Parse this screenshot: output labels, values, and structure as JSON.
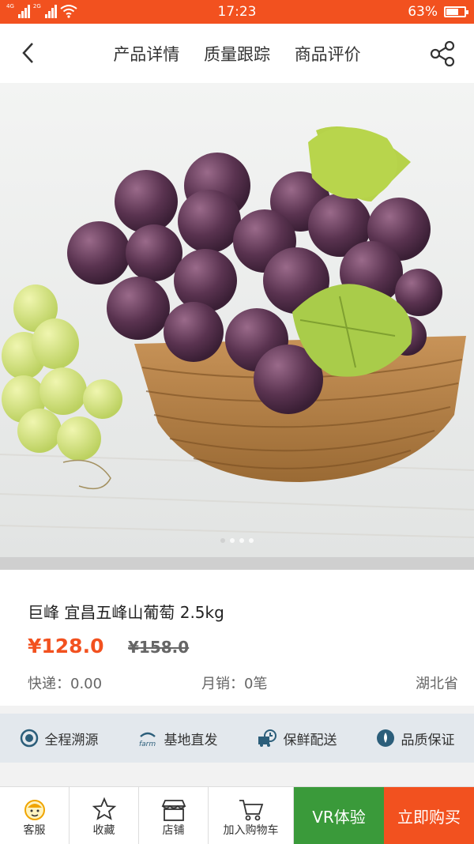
{
  "status_bar": {
    "network_1": "4G",
    "network_2": "2G",
    "time": "17:23",
    "battery": "63%"
  },
  "nav": {
    "tabs": [
      "产品详情",
      "质量跟踪",
      "商品评价"
    ]
  },
  "product": {
    "title": "巨峰 宜昌五峰山葡萄 2.5kg",
    "price": "¥128.0",
    "old_price": "¥158.0",
    "shipping": "快递：0.00",
    "monthly_sales": "月销：0笔",
    "origin": "湖北省"
  },
  "features": [
    "全程溯源",
    "基地直发",
    "保鲜配送",
    "品质保证"
  ],
  "bottom_bar": {
    "service": "客服",
    "favorite": "收藏",
    "store": "店铺",
    "add_cart": "加入购物车",
    "vr": "VR体验",
    "buy_now": "立即购买"
  },
  "colors": {
    "accent": "#f2511f",
    "vr": "#3a9a3a"
  },
  "icons": {
    "farm_label": "farm"
  }
}
